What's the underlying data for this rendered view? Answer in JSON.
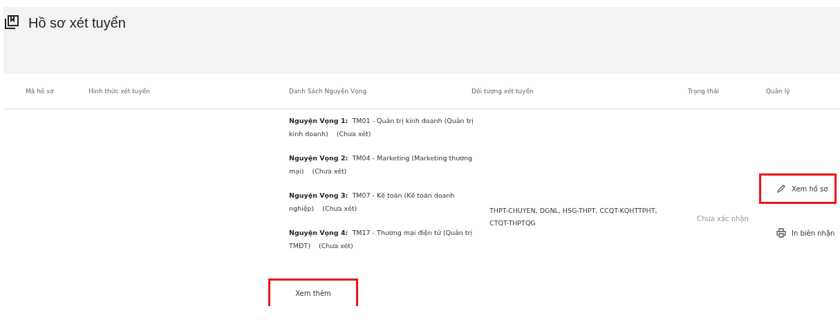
{
  "page": {
    "title": "Hồ sơ xét tuyển"
  },
  "table": {
    "columns": [
      "Mã hồ sơ",
      "Hình thức xét tuyển",
      "Danh Sách Nguyện Vọng",
      "Đối tượng xét tuyển",
      "Trạng thái",
      "Quản lý"
    ],
    "rows": [
      {
        "wishes": [
          {
            "label": "Nguyện Vọng 1:",
            "text": "TM01 - Quản trị kinh doanh (Quản trị kinh doanh)",
            "status": "(Chưa xét)"
          },
          {
            "label": "Nguyện Vọng 2:",
            "text": "TM04 - Marketing (Marketing thương mại)",
            "status": "(Chưa xét)"
          },
          {
            "label": "Nguyện Vọng 3:",
            "text": "TM07 - Kế toán (Kế toán doanh nghiệp)",
            "status": "(Chưa xét)"
          },
          {
            "label": "Nguyện Vọng 4:",
            "text": "TM17 - Thương mại điện tử (Quản trị TMĐT)",
            "status": "(Chưa xét)"
          }
        ],
        "see_more": {
          "label": "Xem thêm",
          "highlighted": true
        },
        "target_groups": "THPT-CHUYEN, DGNL, HSG-THPT, CCQT-KQHTTPHT, CTQT-THPTQG",
        "status": "Chưa xác nhận",
        "actions": [
          {
            "kind": "edit",
            "label": "Xem hồ sơ",
            "highlighted": true
          },
          {
            "kind": "print",
            "label": "In biên nhận",
            "highlighted": false
          }
        ]
      }
    ]
  }
}
